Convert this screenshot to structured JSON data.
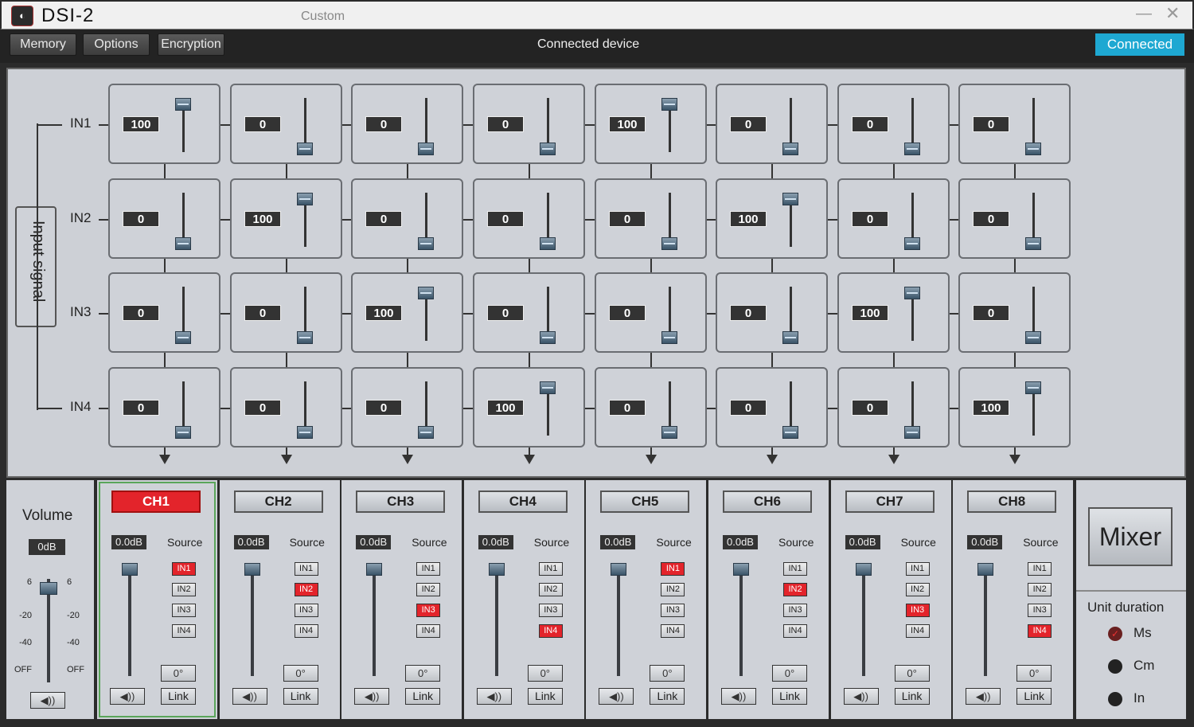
{
  "window": {
    "app_title": "DSI-2",
    "preset": "Custom",
    "minimize": "—",
    "close": "✕",
    "logo": "◐"
  },
  "menu": {
    "memory": "Memory",
    "options": "Options",
    "encryption": "Encryption",
    "connected_label": "Connected device",
    "connected_button": "Connected"
  },
  "matrix": {
    "side_label": "Input signal",
    "inputs": [
      "IN1",
      "IN2",
      "IN3",
      "IN4"
    ],
    "values": [
      [
        100,
        0,
        0,
        0,
        100,
        0,
        0,
        0
      ],
      [
        0,
        100,
        0,
        0,
        0,
        100,
        0,
        0
      ],
      [
        0,
        0,
        100,
        0,
        0,
        0,
        100,
        0
      ],
      [
        0,
        0,
        0,
        100,
        0,
        0,
        0,
        100
      ]
    ]
  },
  "volume": {
    "title": "Volume",
    "value": "0dB",
    "scale": [
      "6",
      "-20",
      "-40",
      "OFF"
    ],
    "mute": "◀))"
  },
  "channels": [
    {
      "name": "CH1",
      "active": true,
      "gain": "0.0dB",
      "source": "IN1"
    },
    {
      "name": "CH2",
      "active": false,
      "gain": "0.0dB",
      "source": "IN2"
    },
    {
      "name": "CH3",
      "active": false,
      "gain": "0.0dB",
      "source": "IN3"
    },
    {
      "name": "CH4",
      "active": false,
      "gain": "0.0dB",
      "source": "IN4"
    },
    {
      "name": "CH5",
      "active": false,
      "gain": "0.0dB",
      "source": "IN1"
    },
    {
      "name": "CH6",
      "active": false,
      "gain": "0.0dB",
      "source": "IN2"
    },
    {
      "name": "CH7",
      "active": false,
      "gain": "0.0dB",
      "source": "IN3"
    },
    {
      "name": "CH8",
      "active": false,
      "gain": "0.0dB",
      "source": "IN4"
    }
  ],
  "channel_labels": {
    "source": "Source",
    "phase": "0°",
    "link": "Link",
    "mute": "◀))",
    "source_options": [
      "IN1",
      "IN2",
      "IN3",
      "IN4"
    ]
  },
  "mixer": {
    "label": "Mixer"
  },
  "units": {
    "title": "Unit duration",
    "options": [
      "Ms",
      "Cm",
      "In"
    ],
    "selected": "Ms"
  }
}
